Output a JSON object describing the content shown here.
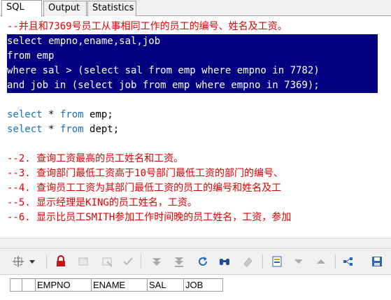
{
  "tabs": [
    {
      "label": "SQL",
      "active": true
    },
    {
      "label": "Output",
      "active": false
    },
    {
      "label": "Statistics",
      "active": false
    }
  ],
  "editor": {
    "comment_top": "--并且和7369号员工从事相同工作的员工的编号、姓名及工资。",
    "selected_lines": [
      "select empno,ename,sal,job",
      "from emp",
      "where sal > (select sal from emp where empno in 7782)",
      "and job in (select job from emp where empno in 7369);"
    ],
    "line_select_emp": {
      "kw1": "select",
      "star": " * ",
      "kw2": "from",
      "rest": " emp;"
    },
    "line_select_dept": {
      "kw1": "select",
      "star": " * ",
      "kw2": "from",
      "rest": " dept;"
    },
    "comments": [
      "--2. 查询工资最高的员工姓名和工资。",
      "--3. 查询部门最低工资高于10号部门最低工资的部门的编号、",
      "--4. 查询员工工资为其部门最低工资的员工的编号和姓名及工",
      "--5. 显示经理是KING的员工姓名，工资。",
      "--6. 显示比员工SMITH参加工作时间晚的员工姓名，工资，参加"
    ]
  },
  "grid": {
    "columns": [
      "EMPNO",
      "ENAME",
      "SAL",
      "JOB"
    ]
  },
  "colors": {
    "selection": "#000080",
    "comment": "#e00000",
    "keyword": "#1a6fbd"
  },
  "toolbar_icons": [
    "grid-select-icon",
    "dropdown-arrow-icon",
    "lock-icon",
    "insert-record-icon",
    "delete-record-icon",
    "post-record-icon",
    "first-record-icon",
    "last-record-icon",
    "refresh-icon",
    "find-icon",
    "clear-icon",
    "export-icon",
    "next-record-icon",
    "prior-record-icon",
    "tree-icon",
    "save-icon"
  ]
}
